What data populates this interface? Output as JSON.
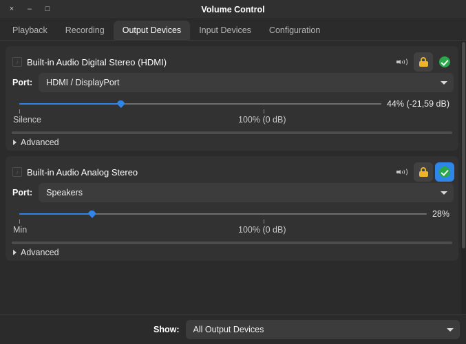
{
  "window": {
    "title": "Volume Control",
    "controls": {
      "close": "×",
      "minimize": "–",
      "maximize": "□"
    }
  },
  "tabs": [
    {
      "label": "Playback",
      "active": false
    },
    {
      "label": "Recording",
      "active": false
    },
    {
      "label": "Output Devices",
      "active": true
    },
    {
      "label": "Input Devices",
      "active": false
    },
    {
      "label": "Configuration",
      "active": false
    }
  ],
  "devices": [
    {
      "name": "Built-in Audio Digital Stereo (HDMI)",
      "port_label": "Port:",
      "port_value": "HDMI / DisplayPort",
      "volume_percent": 44,
      "volume_text": "44% (-21,59 dB)",
      "slider_min_label": "Silence",
      "slider_max_label": "100% (0 dB)",
      "advanced_label": "Advanced",
      "mute_icon": "speaker-icon",
      "lock_icon": "lock-icon",
      "default_icon": "check-circle-icon",
      "default_active": false
    },
    {
      "name": "Built-in Audio Analog Stereo",
      "port_label": "Port:",
      "port_value": "Speakers",
      "volume_percent": 28,
      "volume_text": "28%",
      "slider_min_label": "Min",
      "slider_max_label": "100% (0 dB)",
      "advanced_label": "Advanced",
      "mute_icon": "speaker-icon",
      "lock_icon": "lock-icon",
      "default_icon": "check-circle-icon",
      "default_active": true
    }
  ],
  "footer": {
    "show_label": "Show:",
    "show_value": "All Output Devices"
  },
  "colors": {
    "accent": "#2f86ea",
    "lock": "#f0b429",
    "check": "#2aa84a",
    "window_bg": "#2b2b2b",
    "card_bg": "#323232"
  }
}
